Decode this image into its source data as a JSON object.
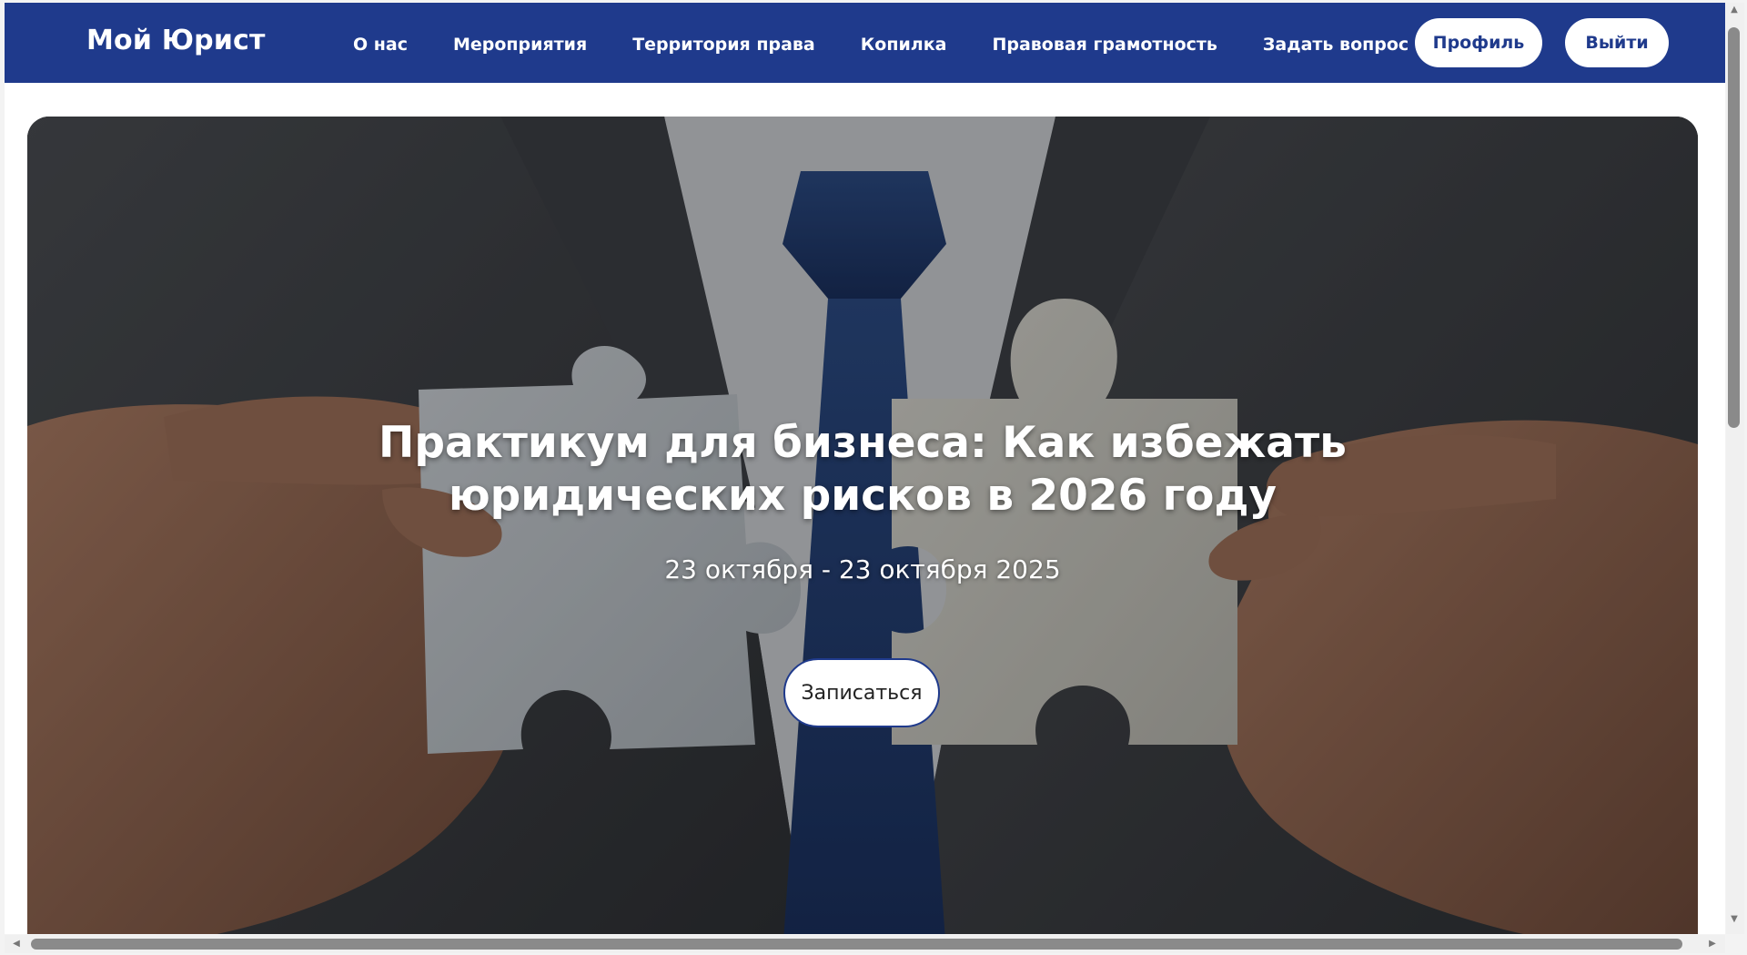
{
  "header": {
    "logo": "Мой Юрист",
    "nav": [
      {
        "label": "О нас"
      },
      {
        "label": "Мероприятия"
      },
      {
        "label": "Территория права"
      },
      {
        "label": "Копилка"
      },
      {
        "label": "Правовая грамотность"
      },
      {
        "label": "Задать вопрос"
      }
    ],
    "profile_label": "Профиль",
    "logout_label": "Выйти"
  },
  "hero": {
    "title": "Практикум для бизнеса: Как избежать юридических рисков в 2026 году",
    "date": "23 октября - 23 октября 2025",
    "button_label": "Записаться",
    "image_subject": "hands-holding-puzzle-pieces"
  },
  "colors": {
    "header_bg": "#1f3a8c",
    "accent": "#1f3a8c",
    "button_bg": "#ffffff"
  },
  "icons": {
    "scroll_up": "scroll-up-arrow-icon",
    "scroll_down": "scroll-down-arrow-icon",
    "scroll_left": "scroll-left-arrow-icon",
    "scroll_right": "scroll-right-arrow-icon"
  }
}
